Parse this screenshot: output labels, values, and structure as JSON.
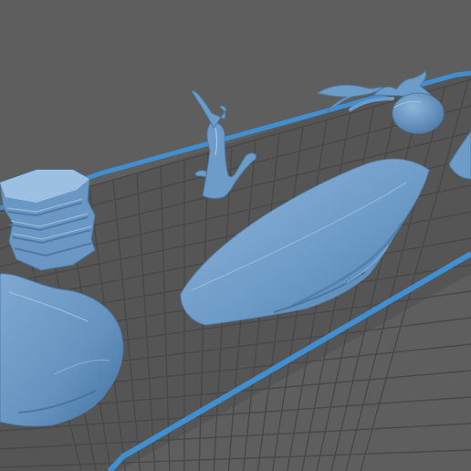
{
  "viewer": {
    "background_color": "#5e5e5e",
    "bed_color": "#555555",
    "grid_line_color": "#4a4a4a",
    "bed_border_color": "#3f8fd2",
    "model_color": "#6e9cc8",
    "model_shadow_color": "#4a7aa8",
    "model_highlight_color": "#a7c9e6"
  },
  "models": [
    {
      "name": "stacked-slate-rock"
    },
    {
      "name": "dead-tree-trunk"
    },
    {
      "name": "tentacle-plant"
    },
    {
      "name": "flat-boulder-slab"
    },
    {
      "name": "large-rounded-boulder"
    },
    {
      "name": "partial-rock-edge"
    }
  ]
}
